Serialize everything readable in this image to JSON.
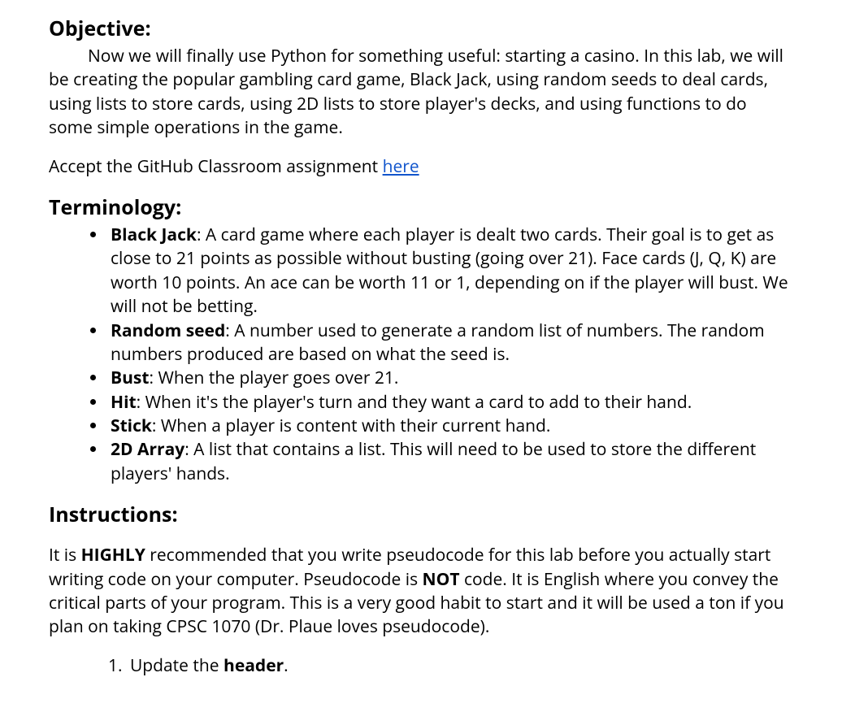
{
  "objective": {
    "heading": "Objective:",
    "body": "Now we will finally use Python for something useful: starting a casino. In this lab, we will be creating the popular gambling card game, Black Jack, using random seeds to deal cards, using lists to store cards, using 2D lists to store player's decks, and using functions to do some simple operations in the game.",
    "github_prefix": "Accept the GitHub Classroom assignment ",
    "github_link_text": "here"
  },
  "terminology": {
    "heading": "Terminology:",
    "items": [
      {
        "term": "Black Jack",
        "definition": ": A card game where each player is dealt two cards. Their goal is to get as close to 21 points as possible without busting (going over 21). Face cards (J, Q, K) are worth 10 points. An ace can be worth 11 or 1, depending on if the player will bust. We will not be betting."
      },
      {
        "term": "Random seed",
        "definition": ": A number used to generate a random list of numbers. The random numbers produced are based on what the seed is."
      },
      {
        "term": "Bust",
        "definition": ": When the player goes over 21."
      },
      {
        "term": "Hit",
        "definition": ": When it's the player's turn and they want a card to add to their hand."
      },
      {
        "term": "Stick",
        "definition": ": When a player is content with their current hand."
      },
      {
        "term": "2D Array",
        "definition": ": A list that contains a list. This will need to be used to store the different players' hands."
      }
    ]
  },
  "instructions": {
    "heading": "Instructions:",
    "intro_part1": "It is ",
    "intro_bold1": "HIGHLY",
    "intro_part2": " recommended that you write pseudocode for this lab before you actually start writing code on your computer. Pseudocode is ",
    "intro_bold2": "NOT",
    "intro_part3": " code. It is English where you convey the critical parts of your program. This is a very good habit to start and it will be used a ton if you plan on taking CPSC 1070 (Dr. Plaue loves pseudocode).",
    "steps": [
      {
        "prefix": "Update the ",
        "bold": "header",
        "suffix": "."
      }
    ]
  }
}
